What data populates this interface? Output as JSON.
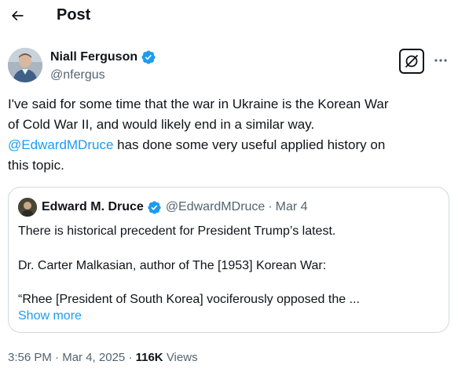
{
  "header": {
    "back_icon": "arrow-left-icon",
    "title": "Post"
  },
  "author": {
    "name": "Niall Ferguson",
    "handle": "@nfergus",
    "verified_color": "#1d9bf0"
  },
  "actions": {
    "grok_icon": "grok-icon",
    "more_icon": "more-horizontal-icon"
  },
  "tweet": {
    "line1": "I've said for some time that the war in Ukraine is the Korean War",
    "line2": "of Cold War II, and would likely end in a similar way.",
    "mention": "@EdwardMDruce",
    "line3_rest": " has done some very useful applied history on",
    "line4": "this topic."
  },
  "quote": {
    "name": "Edward M. Druce",
    "handle": "@EdwardMDruce",
    "separator": "·",
    "date": "Mar 4",
    "line1": "There is historical precedent for President Trump’s latest.",
    "line2": "Dr. Carter Malkasian, author of The [1953] Korean War:",
    "line3": "“Rhee [President of South Korea] vociferously opposed the ...",
    "show_more": "Show more"
  },
  "meta": {
    "time": "3:56 PM",
    "separator": "·",
    "date": "Mar 4, 2025",
    "views_count": "116K",
    "views_label": "Views"
  },
  "colors": {
    "text": "#0f1419",
    "secondary": "#536471",
    "link": "#1d9bf0",
    "border": "#cfd9de"
  }
}
